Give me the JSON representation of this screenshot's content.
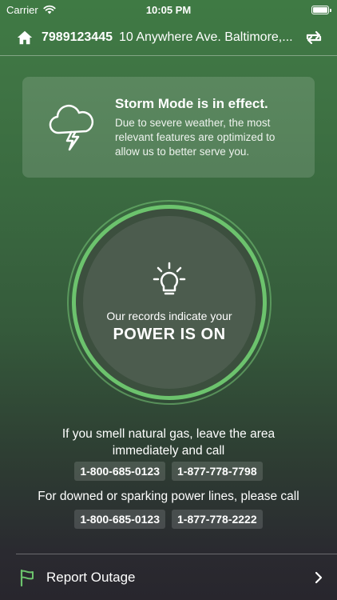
{
  "status_bar": {
    "carrier": "Carrier",
    "time": "10:05 PM"
  },
  "header": {
    "account_number": "7989123445",
    "address": "10 Anywhere Ave. Baltimore,..."
  },
  "storm": {
    "title": "Storm Mode is in effect.",
    "message": "Due to severe weather, the most relevant features are optimized to allow us to better serve you."
  },
  "power_status": {
    "intro": "Our records indicate your",
    "status": "POWER IS ON"
  },
  "gas": {
    "message": "If you smell natural gas, leave the area immediately and call",
    "phones": [
      "1-800-685-0123",
      "1-877-778-7798"
    ]
  },
  "power_lines": {
    "message": "For downed or sparking power lines, please call",
    "phones": [
      "1-800-685-0123",
      "1-877-778-2222"
    ]
  },
  "report_outage": {
    "label": "Report Outage"
  },
  "colors": {
    "accent_green": "#6cc36d"
  }
}
